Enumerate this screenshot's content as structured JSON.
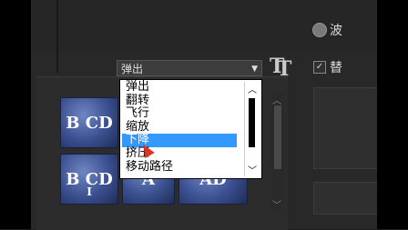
{
  "animation_select": {
    "value": "弹出",
    "options": [
      "弹出",
      "翻转",
      "飞行",
      "缩放",
      "下降",
      "挤压",
      "移动路径"
    ],
    "selected_index": 4
  },
  "tiles": [
    {
      "text": "B CD",
      "sub": ""
    },
    {
      "text": "A",
      "sub": ""
    },
    {
      "text": "A",
      "sub": ""
    },
    {
      "text": "B CD",
      "sub": "I"
    },
    {
      "text": "A",
      "sub": ""
    },
    {
      "text": "AD",
      "sub": ""
    }
  ],
  "right_labels": {
    "radio_fragment": "波",
    "checkbox_fragment": "替"
  },
  "colors": {
    "selection": "#3399ff",
    "background": "#282828"
  }
}
